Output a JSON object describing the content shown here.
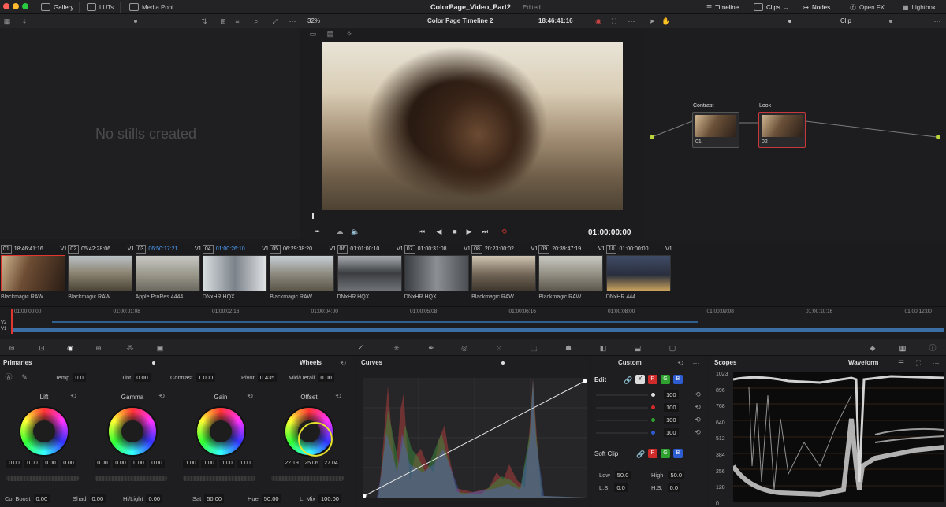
{
  "topbar": {
    "gallery": "Gallery",
    "luts": "LUTs",
    "media_pool": "Media Pool",
    "project": "ColorPage_Video_Part2",
    "status": "Edited",
    "timeline": "Timeline",
    "clips": "Clips",
    "nodes": "Nodes",
    "openfx": "Open FX",
    "lightbox": "Lightbox"
  },
  "viewer": {
    "zoom": "32%",
    "timeline_name": "Color Page Timeline 2",
    "timecode": "18:46:41:16",
    "playhead_tc": "01:00:00:00"
  },
  "gallery": {
    "empty": "No stills created"
  },
  "nodes": {
    "mode": "Clip",
    "n1": {
      "label": "Contrast",
      "id": "01"
    },
    "n2": {
      "label": "Look",
      "id": "02"
    }
  },
  "clips": [
    {
      "num": "01",
      "tc": "18:46:41:16",
      "track": "V1",
      "codec": "Blackmagic RAW",
      "g": "linear-gradient(110deg,#cdb48e,#6d4c33 40%,#2a1d15)"
    },
    {
      "num": "02",
      "tc": "05:42:28:06",
      "track": "V1",
      "codec": "Blackmagic RAW",
      "g": "linear-gradient(180deg,#b9c1c6,#8c8472 50%,#4b4538)"
    },
    {
      "num": "03",
      "tc": "06:50:17:21",
      "track": "V1",
      "codec": "Apple ProRes 4444",
      "g": "linear-gradient(180deg,#c7c8c4,#9a978a 55%,#6b6a60)"
    },
    {
      "num": "04",
      "tc": "01:00:26:10",
      "track": "V1",
      "codec": "DNxHR HQX",
      "g": "linear-gradient(90deg,#d8dde0,#7b828a 50%,#e2e4e6)"
    },
    {
      "num": "05",
      "tc": "06:29:38:20",
      "track": "V1",
      "codec": "Blackmagic RAW",
      "g": "linear-gradient(180deg,#c7cfd6,#8f8c82 50%,#5b5648)"
    },
    {
      "num": "06",
      "tc": "01:01:00:10",
      "track": "V1",
      "codec": "DNxHR HQX",
      "g": "linear-gradient(180deg,#a8acb0,#3b3d40 50%,#6e7276)"
    },
    {
      "num": "07",
      "tc": "01:00:31:08",
      "track": "V1",
      "codec": "DNxHR HQX",
      "g": "linear-gradient(90deg,#3a3e42,#8c9094 50%,#4a4e52)"
    },
    {
      "num": "08",
      "tc": "20:23:00:02",
      "track": "V1",
      "codec": "Blackmagic RAW",
      "g": "linear-gradient(180deg,#cfc5b2,#6e6354 55%,#3f372d)"
    },
    {
      "num": "09",
      "tc": "20:39:47:19",
      "track": "V1",
      "codec": "Blackmagic RAW",
      "g": "linear-gradient(180deg,#c9c9c2,#8b877b 60%,#5c584e)"
    },
    {
      "num": "10",
      "tc": "01:00:00:00",
      "track": "V1",
      "codec": "DNxHR 444",
      "g": "linear-gradient(180deg,#3f4b66,#2a2f3d 55%,#c8a15c)"
    }
  ],
  "ruler": [
    "01:00:00:00",
    "01:00:01:08",
    "01:00:02:16",
    "01:00:04:00",
    "01:00:05:08",
    "01:00:06:16",
    "01:00:08:00",
    "01:00:09:08",
    "01:00:10:16",
    "01:00:12:00"
  ],
  "tracks": [
    "V2",
    "V1"
  ],
  "primaries": {
    "title": "Primaries",
    "mode": "Wheels",
    "temp_l": "Temp",
    "temp": "0.0",
    "tint_l": "Tint",
    "tint": "0.00",
    "contrast_l": "Contrast",
    "contrast": "1.000",
    "pivot_l": "Pivot",
    "pivot": "0.435",
    "md_l": "Mid/Detail",
    "md": "0.00",
    "wheels": [
      {
        "name": "Lift",
        "vals": [
          "0.00",
          "0.00",
          "0.00",
          "0.00"
        ]
      },
      {
        "name": "Gamma",
        "vals": [
          "0.00",
          "0.00",
          "0.00",
          "0.00"
        ]
      },
      {
        "name": "Gain",
        "vals": [
          "1.00",
          "1.00",
          "1.00",
          "1.00"
        ]
      },
      {
        "name": "Offset",
        "vals": [
          "22.19",
          "25.06",
          "27.04"
        ]
      }
    ],
    "colboost_l": "Col Boost",
    "colboost": "0.00",
    "shad_l": "Shad",
    "shad": "0.00",
    "hilight_l": "Hi/Light",
    "hilight": "0.00",
    "sat_l": "Sat",
    "sat": "50.00",
    "hue_l": "Hue",
    "hue": "50.00",
    "lmix_l": "L. Mix",
    "lmix": "100.00"
  },
  "curves": {
    "title": "Curves",
    "mode": "Custom"
  },
  "edit": {
    "title": "Edit",
    "y": "Y",
    "r": "R",
    "g": "G",
    "b": "B",
    "vals": [
      "100",
      "100",
      "100",
      "100"
    ],
    "softclip": "Soft Clip",
    "low_l": "Low",
    "low": "50.0",
    "high_l": "High",
    "high": "50.0",
    "ls_l": "L.S.",
    "ls": "0.0",
    "hs_l": "H.S.",
    "hs": "0.0"
  },
  "scopes": {
    "title": "Scopes",
    "mode": "Waveform",
    "ticks": [
      "1023",
      "896",
      "768",
      "640",
      "512",
      "384",
      "256",
      "128",
      "0"
    ]
  },
  "colors": {
    "accent": "#e0362f",
    "blue_tc": "#4ea2ff",
    "node_outline": "#c8383a"
  }
}
